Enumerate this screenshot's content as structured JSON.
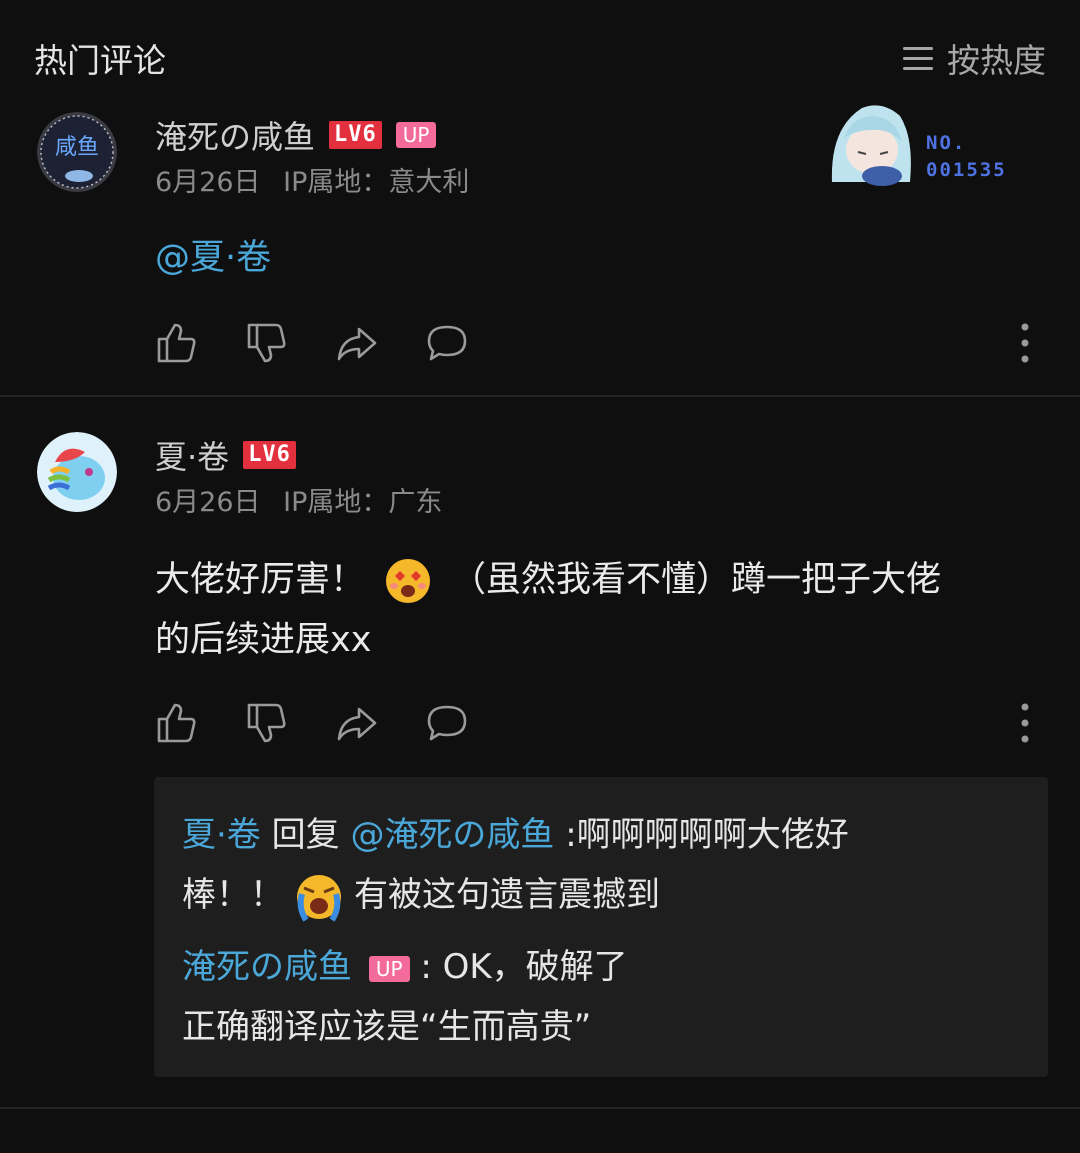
{
  "header": {
    "title": "热门评论",
    "sort_label": "按热度"
  },
  "comments": [
    {
      "username": "淹死の咸鱼",
      "level": "LV6",
      "up_badge": "UP",
      "date": "6月26日",
      "ip": "IP属地：意大利",
      "text": "@夏·卷",
      "avatar_text": "咸鱼",
      "pendant_no": "NO.",
      "pendant_id": "001535"
    },
    {
      "username": "夏·卷",
      "level": "LV6",
      "date": "6月26日",
      "ip": "IP属地：广东",
      "text_part1": "大佬好厉害！",
      "text_part2": "（虽然我看不懂）蹲一把子大佬",
      "text_line2": "的后续进展xx"
    }
  ],
  "replies": [
    {
      "author": "夏·卷",
      "verb": "回复",
      "target": "@淹死の咸鱼",
      "line1": ":啊啊啊啊啊大佬好",
      "line2a": "棒！！",
      "line2b": "有被这句遗言震撼到"
    },
    {
      "author": "淹死の咸鱼",
      "up_badge": "UP",
      "line1": ": OK，破解了",
      "line2": "正确翻译应该是“生而高贵”"
    }
  ],
  "colors": {
    "mention": "#4aa7d8",
    "level_badge": "#e3303e",
    "up_badge": "#f26b9a",
    "pendant_text": "#4f72e3"
  }
}
